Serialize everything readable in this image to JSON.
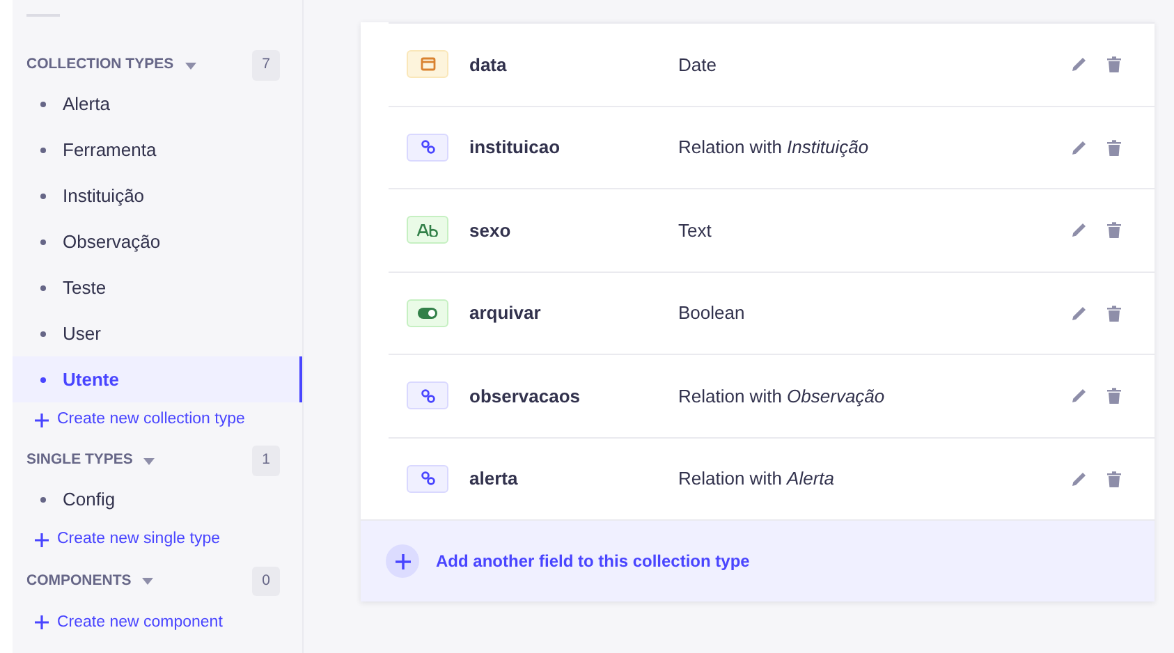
{
  "sidebar": {
    "sections": [
      {
        "title": "COLLECTION TYPES",
        "count": "7",
        "items": [
          {
            "label": "Alerta",
            "selected": false
          },
          {
            "label": "Ferramenta",
            "selected": false
          },
          {
            "label": "Instituição",
            "selected": false
          },
          {
            "label": "Observação",
            "selected": false
          },
          {
            "label": "Teste",
            "selected": false
          },
          {
            "label": "User",
            "selected": false
          },
          {
            "label": "Utente",
            "selected": true
          }
        ],
        "create": "Create new collection type"
      },
      {
        "title": "SINGLE TYPES",
        "count": "1",
        "items": [
          {
            "label": "Config",
            "selected": false
          }
        ],
        "create": "Create new single type"
      },
      {
        "title": "COMPONENTS",
        "count": "0",
        "create": "Create new component"
      }
    ]
  },
  "fields": [
    {
      "kind": "date",
      "name": "data",
      "type": "Date"
    },
    {
      "kind": "relation",
      "name": "instituicao",
      "type": "Relation with *Instituição*"
    },
    {
      "kind": "text",
      "name": "sexo",
      "type": "Text"
    },
    {
      "kind": "boolean",
      "name": "arquivar",
      "type": "Boolean"
    },
    {
      "kind": "relation",
      "name": "observacaos",
      "type": "Relation with *Observação*"
    },
    {
      "kind": "relation",
      "name": "alerta",
      "type": "Relation with *Alerta*"
    }
  ],
  "add_field": "Add another field to this collection type"
}
